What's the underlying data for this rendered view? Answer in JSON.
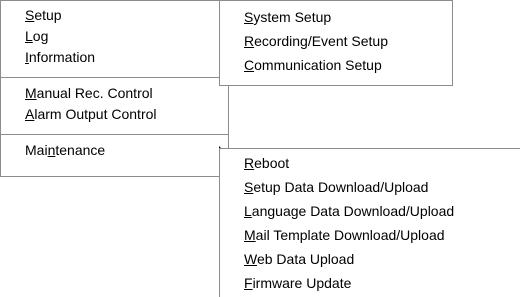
{
  "main_menu": {
    "groups": [
      [
        {
          "pre": "",
          "key": "S",
          "post": "etup",
          "has_submenu": true
        },
        {
          "pre": "",
          "key": "L",
          "post": "og",
          "has_submenu": false
        },
        {
          "pre": "",
          "key": "I",
          "post": "nformation",
          "has_submenu": false
        }
      ],
      [
        {
          "pre": "",
          "key": "M",
          "post": "anual Rec. Control",
          "has_submenu": false
        },
        {
          "pre": "",
          "key": "A",
          "post": "larm Output Control",
          "has_submenu": false
        }
      ],
      [
        {
          "pre": "Mai",
          "key": "n",
          "post": "tenance",
          "has_submenu": true
        }
      ]
    ]
  },
  "setup_submenu": {
    "items": [
      {
        "pre": "",
        "key": "S",
        "post": "ystem Setup"
      },
      {
        "pre": "",
        "key": "R",
        "post": "ecording/Event Setup"
      },
      {
        "pre": "",
        "key": "C",
        "post": "ommunication Setup"
      }
    ]
  },
  "maintenance_submenu": {
    "items": [
      {
        "pre": "",
        "key": "R",
        "post": "eboot"
      },
      {
        "pre": "",
        "key": "S",
        "post": "etup Data Download/Upload"
      },
      {
        "pre": "",
        "key": "L",
        "post": "anguage Data Download/Upload"
      },
      {
        "pre": "",
        "key": "M",
        "post": "ail Template Download/Upload"
      },
      {
        "pre": "",
        "key": "W",
        "post": "eb Data Upload"
      },
      {
        "pre": "",
        "key": "F",
        "post": "irmware Update"
      }
    ]
  }
}
